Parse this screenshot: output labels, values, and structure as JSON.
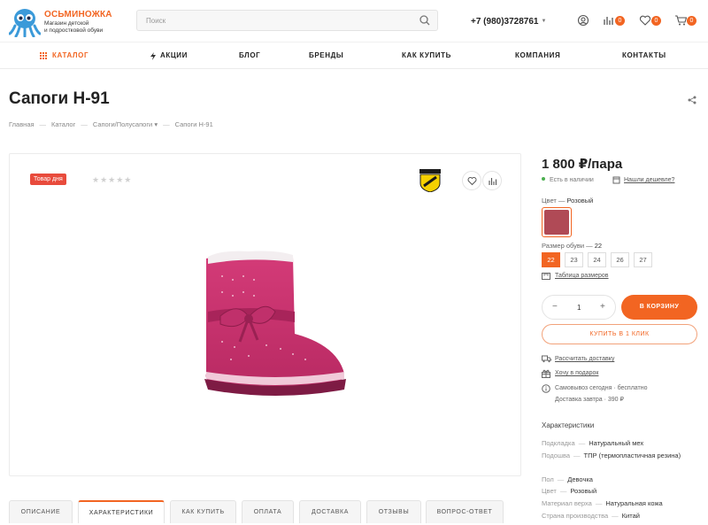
{
  "header": {
    "logo_name": "ОСЬМИНОЖКА",
    "logo_tag_1": "Магазин детской",
    "logo_tag_2": "и подростковой обуви",
    "search_placeholder": "Поиск",
    "phone": "+7 (980)3728761",
    "compare_count": "0",
    "favorites_count": "0",
    "cart_count": "0",
    "accent_color": "#f26522"
  },
  "nav": {
    "items": [
      "КАТАЛОГ",
      "АКЦИИ",
      "БЛОГ",
      "БРЕНДЫ",
      "КАК КУПИТЬ",
      "КОМПАНИЯ",
      "КОНТАКТЫ"
    ]
  },
  "product": {
    "title": "Сапоги H-91",
    "breadcrumbs": [
      "Главная",
      "Каталог",
      "Сапоги/Полусапоги",
      "Сапоги H-91"
    ],
    "deal_badge": "Товар дня",
    "rating_stars": "★★★★★",
    "price": "1 800 ₽/пара",
    "stock": "Есть в наличии",
    "cheaper_link": "Нашли дешевле?",
    "color_label": "Цвет",
    "color_value": "Розовый",
    "size_label": "Размер обуви",
    "size_value": "22",
    "sizes": [
      "22",
      "23",
      "24",
      "26",
      "27"
    ],
    "size_table_link": "Таблица размеров",
    "quantity": "1",
    "add_to_cart": "В КОРЗИНУ",
    "buy_one_click": "КУПИТЬ В 1 КЛИК",
    "delivery_link": "Рассчитать доставку",
    "gift_link": "Хочу в подарок",
    "pickup_line_1": "Самовывоз сегодня · бесплатно",
    "pickup_line_2": "Доставка завтра · 390 ₽"
  },
  "characteristics": {
    "heading": "Характеристики",
    "rows": [
      {
        "k": "Подкладка",
        "v": "Натуральный мех"
      },
      {
        "k": "Подошва",
        "v": "ТПР (термопластичная резина)"
      },
      {
        "k": "Пол",
        "v": "Девочка"
      },
      {
        "k": "Цвет",
        "v": "Розовый"
      },
      {
        "k": "Материал верха",
        "v": "Натуральная кожа"
      },
      {
        "k": "Страна производства",
        "v": "Китай"
      }
    ]
  },
  "tabs": [
    "ОПИСАНИЕ",
    "ХАРАКТЕРИСТИКИ",
    "КАК КУПИТЬ",
    "ОПЛАТА",
    "ДОСТАВКА",
    "ОТЗЫВЫ",
    "ВОПРОС-ОТВЕТ"
  ]
}
